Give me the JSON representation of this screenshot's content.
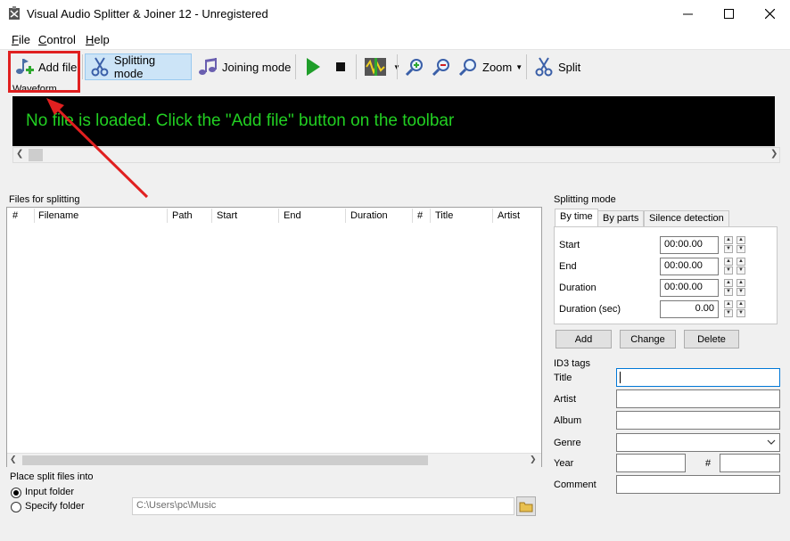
{
  "window": {
    "title": "Visual Audio Splitter & Joiner 12 - Unregistered"
  },
  "menu": [
    {
      "label": "File",
      "key": "F"
    },
    {
      "label": "Control",
      "key": "C"
    },
    {
      "label": "Help",
      "key": "H"
    }
  ],
  "toolbar": {
    "add_file": "Add file",
    "splitting_mode": "Splitting mode",
    "joining_mode": "Joining mode",
    "zoom": "Zoom",
    "split": "Split"
  },
  "waveform": {
    "label": "Waveform",
    "message": "No file is loaded. Click the \"Add file\" button on the toolbar"
  },
  "files": {
    "label": "Files for splitting",
    "columns": [
      "#",
      "Filename",
      "Path",
      "Start",
      "End",
      "Duration",
      "#",
      "Title",
      "Artist"
    ]
  },
  "place": {
    "label": "Place split files into",
    "input_folder": "Input folder",
    "specify_folder": "Specify folder",
    "path": "C:\\Users\\pc\\Music"
  },
  "splitting_mode": {
    "label": "Splitting mode",
    "tabs": [
      "By time",
      "By parts",
      "Silence detection"
    ],
    "fields": [
      {
        "label": "Start",
        "value": "00:00.00"
      },
      {
        "label": "End",
        "value": "00:00.00"
      },
      {
        "label": "Duration",
        "value": "00:00.00"
      },
      {
        "label": "Duration (sec)",
        "value": "0.00"
      }
    ],
    "buttons": {
      "add": "Add",
      "change": "Change",
      "delete": "Delete"
    }
  },
  "id3": {
    "label": "ID3 tags",
    "title": "Title",
    "artist": "Artist",
    "album": "Album",
    "genre": "Genre",
    "year": "Year",
    "track_hash": "#",
    "comment": "Comment"
  },
  "colors": {
    "highlight": "#e02020",
    "waveform_text": "#22d022",
    "arrow": "#e02020"
  }
}
